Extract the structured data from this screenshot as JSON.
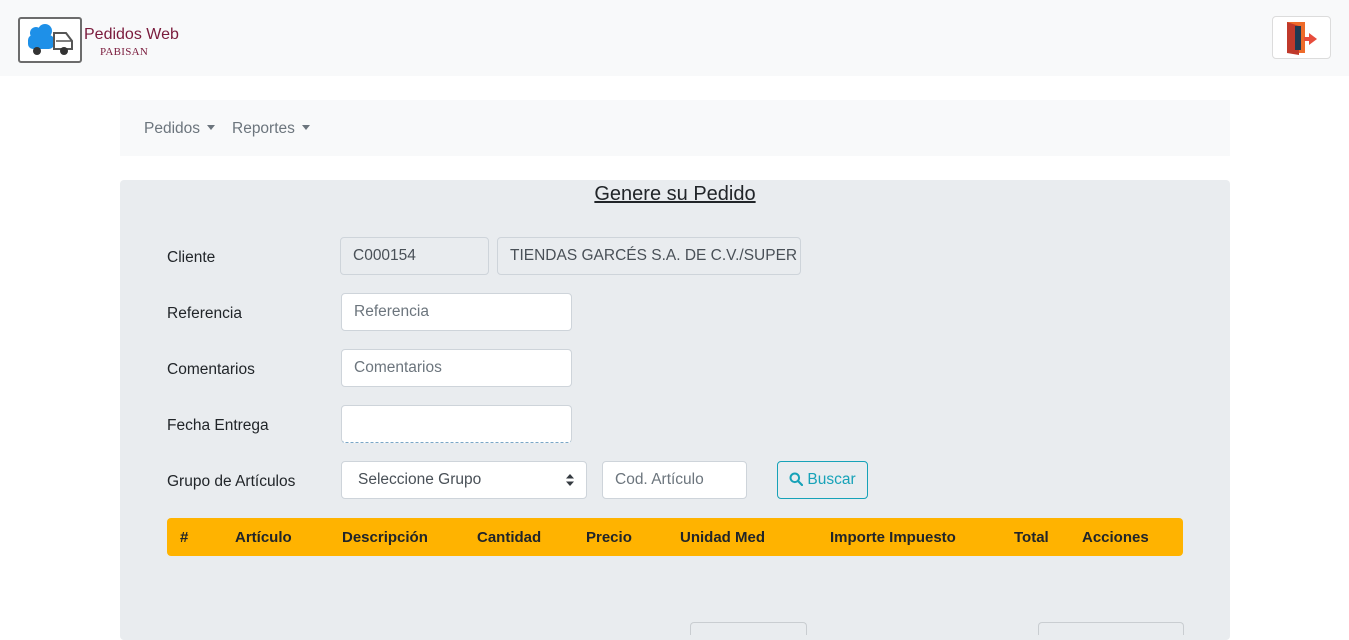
{
  "header": {
    "logo_title": "Pedidos Web",
    "logo_subtitle": "PABISAN",
    "logo_icon": "delivery-truck-icon",
    "logout_icon": "logout-door-icon"
  },
  "nav": {
    "items": [
      {
        "label": "Pedidos"
      },
      {
        "label": "Reportes"
      }
    ]
  },
  "form": {
    "title": "Genere su Pedido",
    "cliente": {
      "label": "Cliente",
      "code": "C000154",
      "name": "TIENDAS GARCÉS S.A. DE C.V./SUPER KC"
    },
    "referencia": {
      "label": "Referencia",
      "placeholder": "Referencia"
    },
    "comentarios": {
      "label": "Comentarios",
      "placeholder": "Comentarios"
    },
    "fecha_entrega": {
      "label": "Fecha Entrega",
      "value": ""
    },
    "grupo": {
      "label": "Grupo de Artículos",
      "selected": "Seleccione Grupo",
      "articulo_placeholder": "Cod. Artículo"
    },
    "buscar_label": "Buscar"
  },
  "table": {
    "columns": [
      "#",
      "Artículo",
      "Descripción",
      "Cantidad",
      "Precio",
      "Unidad Med",
      "Importe Impuesto",
      "Total",
      "Acciones"
    ],
    "rows": []
  },
  "colors": {
    "accent": "#ffb300",
    "info": "#17a2b8",
    "brand": "#7a1b3c",
    "logout": "#e74c3c"
  }
}
